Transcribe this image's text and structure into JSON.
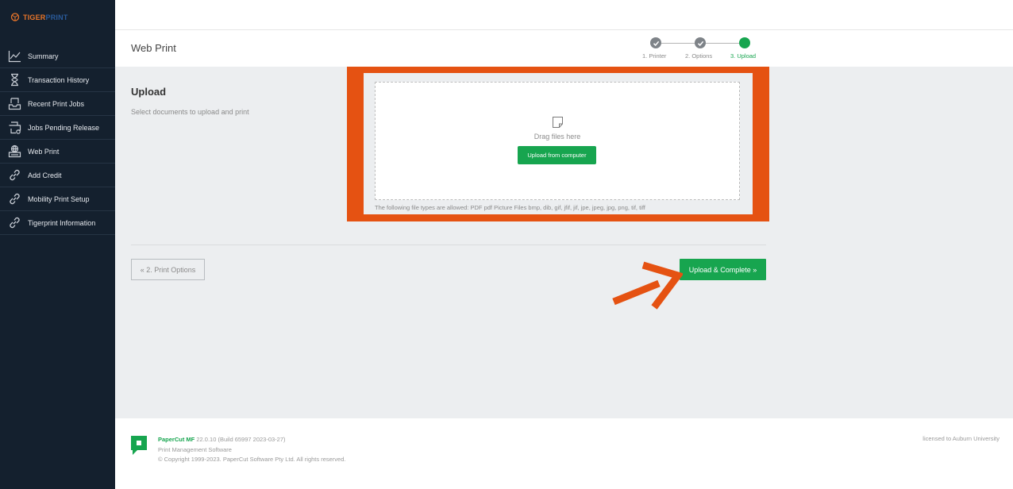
{
  "brand": {
    "logo_part1": "TIGER",
    "logo_part2": "PRINT"
  },
  "sidebar": {
    "items": [
      {
        "label": "Summary",
        "icon": "chart-line-icon"
      },
      {
        "label": "Transaction History",
        "icon": "hourglass-icon"
      },
      {
        "label": "Recent Print Jobs",
        "icon": "inbox-tray-icon"
      },
      {
        "label": "Jobs Pending Release",
        "icon": "printer-release-icon"
      },
      {
        "label": "Web Print",
        "icon": "globe-printer-icon"
      },
      {
        "label": "Add Credit",
        "icon": "link-icon"
      },
      {
        "label": "Mobility Print Setup",
        "icon": "link-icon"
      },
      {
        "label": "Tigerprint Information",
        "icon": "link-icon"
      }
    ]
  },
  "header": {
    "title": "Web Print"
  },
  "steps": [
    {
      "label": "1. Printer",
      "state": "done"
    },
    {
      "label": "2. Options",
      "state": "done"
    },
    {
      "label": "3. Upload",
      "state": "active"
    }
  ],
  "upload": {
    "title": "Upload",
    "subtitle": "Select documents to upload and print",
    "drag_text": "Drag files here",
    "upload_button": "Upload from computer",
    "file_types": "The following file types are allowed: PDF pdf Picture Files bmp, dib, gif, jfif, jif, jpe, jpeg, jpg, png, tif, tiff"
  },
  "actions": {
    "back_label": "« 2. Print Options",
    "complete_label": "Upload & Complete »"
  },
  "footer": {
    "product": "PaperCut MF",
    "version": " 22.0.10 (Build 65997 2023-03-27)",
    "tagline": "Print Management Software",
    "copyright": "© Copyright 1999-2023. PaperCut Software Pty Ltd. All rights reserved.",
    "licensed": "licensed to Auburn University"
  },
  "colors": {
    "sidebar_bg": "#14202e",
    "accent_green": "#17a54f",
    "highlight_orange": "#e55212",
    "logo_orange": "#e8752a",
    "logo_blue": "#2a5a9a"
  }
}
